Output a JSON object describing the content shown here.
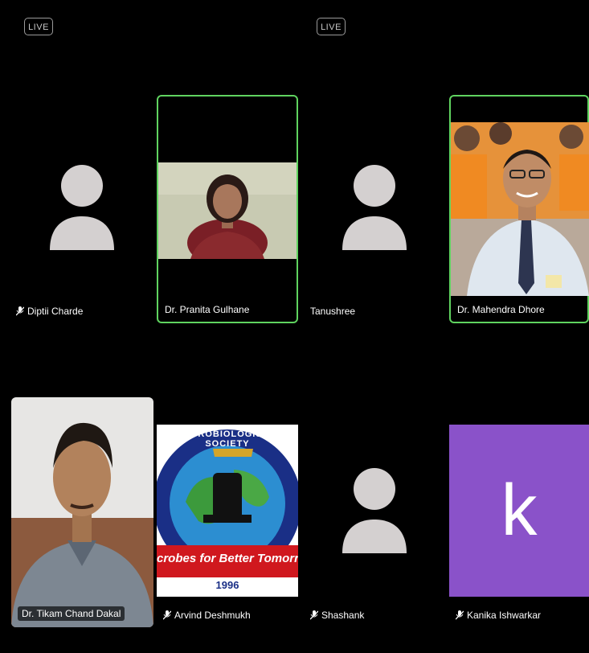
{
  "badges": {
    "live_label": "LIVE"
  },
  "participants": [
    {
      "name": "Diptii Charde",
      "muted": true,
      "active": false,
      "media": "avatar"
    },
    {
      "name": "Dr. Pranita Gulhane",
      "muted": false,
      "active": true,
      "media": "video"
    },
    {
      "name": "Tanushree",
      "muted": false,
      "active": false,
      "media": "avatar"
    },
    {
      "name": "Dr. Mahendra Dhore",
      "muted": false,
      "active": true,
      "media": "video"
    },
    {
      "name": "Dr. Tikam Chand Dakal",
      "muted": false,
      "active": false,
      "media": "video"
    },
    {
      "name": "Arvind Deshmukh",
      "muted": true,
      "active": false,
      "media": "logo"
    },
    {
      "name": "Shashank",
      "muted": true,
      "active": false,
      "media": "avatar"
    },
    {
      "name": "Kanika Ishwarkar",
      "muted": true,
      "active": false,
      "media": "initial"
    }
  ],
  "logo": {
    "arc_top": "MICROBIOLOGISTS SOCIETY",
    "banner": "crobes for Better Tomorr",
    "year": "1996"
  },
  "initial_tile": {
    "letter": "k",
    "color": "#8a52c9"
  },
  "colors": {
    "active_border": "#5fd35f",
    "background": "#000000"
  }
}
